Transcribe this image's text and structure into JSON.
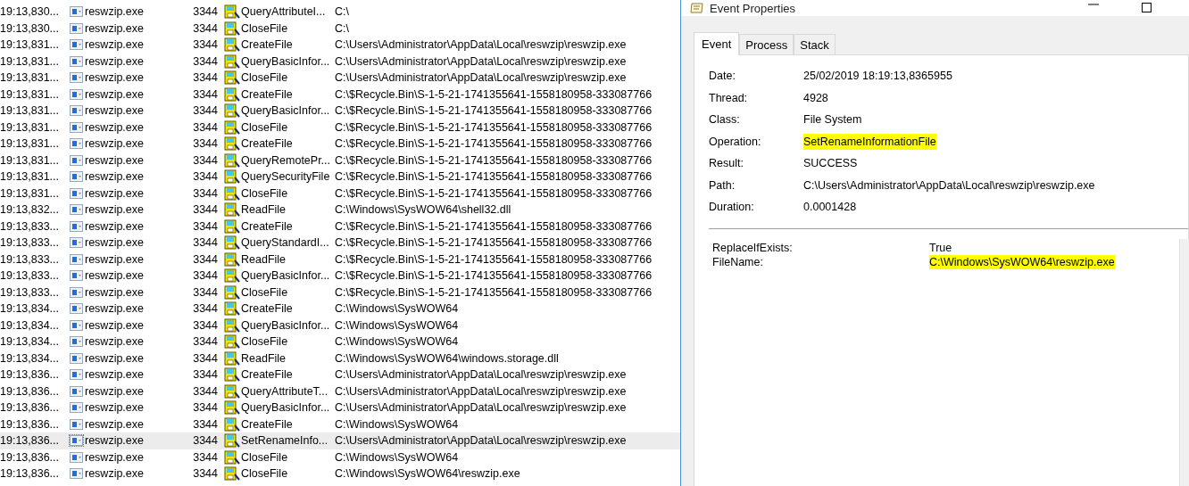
{
  "events": [
    {
      "time": "19:13,830...",
      "process": "reswzip.exe",
      "pid": "3344",
      "operation": "QueryAttributeI...",
      "path": "C:\\",
      "selected": false
    },
    {
      "time": "19:13,830...",
      "process": "reswzip.exe",
      "pid": "3344",
      "operation": "CloseFile",
      "path": "C:\\",
      "selected": false
    },
    {
      "time": "19:13,831...",
      "process": "reswzip.exe",
      "pid": "3344",
      "operation": "CreateFile",
      "path": "C:\\Users\\Administrator\\AppData\\Local\\reswzip\\reswzip.exe",
      "selected": false
    },
    {
      "time": "19:13,831...",
      "process": "reswzip.exe",
      "pid": "3344",
      "operation": "QueryBasicInfor...",
      "path": "C:\\Users\\Administrator\\AppData\\Local\\reswzip\\reswzip.exe",
      "selected": false
    },
    {
      "time": "19:13,831...",
      "process": "reswzip.exe",
      "pid": "3344",
      "operation": "CloseFile",
      "path": "C:\\Users\\Administrator\\AppData\\Local\\reswzip\\reswzip.exe",
      "selected": false
    },
    {
      "time": "19:13,831...",
      "process": "reswzip.exe",
      "pid": "3344",
      "operation": "CreateFile",
      "path": "C:\\$Recycle.Bin\\S-1-5-21-1741355641-1558180958-333087766",
      "selected": false
    },
    {
      "time": "19:13,831...",
      "process": "reswzip.exe",
      "pid": "3344",
      "operation": "QueryBasicInfor...",
      "path": "C:\\$Recycle.Bin\\S-1-5-21-1741355641-1558180958-333087766",
      "selected": false
    },
    {
      "time": "19:13,831...",
      "process": "reswzip.exe",
      "pid": "3344",
      "operation": "CloseFile",
      "path": "C:\\$Recycle.Bin\\S-1-5-21-1741355641-1558180958-333087766",
      "selected": false
    },
    {
      "time": "19:13,831...",
      "process": "reswzip.exe",
      "pid": "3344",
      "operation": "CreateFile",
      "path": "C:\\$Recycle.Bin\\S-1-5-21-1741355641-1558180958-333087766",
      "selected": false
    },
    {
      "time": "19:13,831...",
      "process": "reswzip.exe",
      "pid": "3344",
      "operation": "QueryRemotePr...",
      "path": "C:\\$Recycle.Bin\\S-1-5-21-1741355641-1558180958-333087766",
      "selected": false
    },
    {
      "time": "19:13,831...",
      "process": "reswzip.exe",
      "pid": "3344",
      "operation": "QuerySecurityFile",
      "path": "C:\\$Recycle.Bin\\S-1-5-21-1741355641-1558180958-333087766",
      "selected": false
    },
    {
      "time": "19:13,831...",
      "process": "reswzip.exe",
      "pid": "3344",
      "operation": "CloseFile",
      "path": "C:\\$Recycle.Bin\\S-1-5-21-1741355641-1558180958-333087766",
      "selected": false
    },
    {
      "time": "19:13,832...",
      "process": "reswzip.exe",
      "pid": "3344",
      "operation": "ReadFile",
      "path": "C:\\Windows\\SysWOW64\\shell32.dll",
      "selected": false
    },
    {
      "time": "19:13,833...",
      "process": "reswzip.exe",
      "pid": "3344",
      "operation": "CreateFile",
      "path": "C:\\$Recycle.Bin\\S-1-5-21-1741355641-1558180958-333087766",
      "selected": false
    },
    {
      "time": "19:13,833...",
      "process": "reswzip.exe",
      "pid": "3344",
      "operation": "QueryStandardI...",
      "path": "C:\\$Recycle.Bin\\S-1-5-21-1741355641-1558180958-333087766",
      "selected": false
    },
    {
      "time": "19:13,833...",
      "process": "reswzip.exe",
      "pid": "3344",
      "operation": "ReadFile",
      "path": "C:\\$Recycle.Bin\\S-1-5-21-1741355641-1558180958-333087766",
      "selected": false
    },
    {
      "time": "19:13,833...",
      "process": "reswzip.exe",
      "pid": "3344",
      "operation": "QueryBasicInfor...",
      "path": "C:\\$Recycle.Bin\\S-1-5-21-1741355641-1558180958-333087766",
      "selected": false
    },
    {
      "time": "19:13,833...",
      "process": "reswzip.exe",
      "pid": "3344",
      "operation": "CloseFile",
      "path": "C:\\$Recycle.Bin\\S-1-5-21-1741355641-1558180958-333087766",
      "selected": false
    },
    {
      "time": "19:13,834...",
      "process": "reswzip.exe",
      "pid": "3344",
      "operation": "CreateFile",
      "path": "C:\\Windows\\SysWOW64",
      "selected": false
    },
    {
      "time": "19:13,834...",
      "process": "reswzip.exe",
      "pid": "3344",
      "operation": "QueryBasicInfor...",
      "path": "C:\\Windows\\SysWOW64",
      "selected": false
    },
    {
      "time": "19:13,834...",
      "process": "reswzip.exe",
      "pid": "3344",
      "operation": "CloseFile",
      "path": "C:\\Windows\\SysWOW64",
      "selected": false
    },
    {
      "time": "19:13,834...",
      "process": "reswzip.exe",
      "pid": "3344",
      "operation": "ReadFile",
      "path": "C:\\Windows\\SysWOW64\\windows.storage.dll",
      "selected": false
    },
    {
      "time": "19:13,836...",
      "process": "reswzip.exe",
      "pid": "3344",
      "operation": "CreateFile",
      "path": "C:\\Users\\Administrator\\AppData\\Local\\reswzip\\reswzip.exe",
      "selected": false
    },
    {
      "time": "19:13,836...",
      "process": "reswzip.exe",
      "pid": "3344",
      "operation": "QueryAttributeT...",
      "path": "C:\\Users\\Administrator\\AppData\\Local\\reswzip\\reswzip.exe",
      "selected": false
    },
    {
      "time": "19:13,836...",
      "process": "reswzip.exe",
      "pid": "3344",
      "operation": "QueryBasicInfor...",
      "path": "C:\\Users\\Administrator\\AppData\\Local\\reswzip\\reswzip.exe",
      "selected": false
    },
    {
      "time": "19:13,836...",
      "process": "reswzip.exe",
      "pid": "3344",
      "operation": "CreateFile",
      "path": "C:\\Windows\\SysWOW64",
      "selected": false
    },
    {
      "time": "19:13,836...",
      "process": "reswzip.exe",
      "pid": "3344",
      "operation": "SetRenameInfo...",
      "path": "C:\\Users\\Administrator\\AppData\\Local\\reswzip\\reswzip.exe",
      "selected": true
    },
    {
      "time": "19:13,836...",
      "process": "reswzip.exe",
      "pid": "3344",
      "operation": "CloseFile",
      "path": "C:\\Windows\\SysWOW64",
      "selected": false
    },
    {
      "time": "19:13,836...",
      "process": "reswzip.exe",
      "pid": "3344",
      "operation": "CloseFile",
      "path": "C:\\Windows\\SysWOW64\\reswzip.exe",
      "selected": false
    }
  ],
  "dialog": {
    "title": "Event Properties",
    "tabs": [
      {
        "label": "Event",
        "selected": true
      },
      {
        "label": "Process",
        "selected": false
      },
      {
        "label": "Stack",
        "selected": false
      }
    ],
    "fields": [
      {
        "label": "Date:",
        "value": "25/02/2019 18:19:13,8365955",
        "highlighted": false
      },
      {
        "label": "Thread:",
        "value": "4928",
        "highlighted": false
      },
      {
        "label": "Class:",
        "value": "File System",
        "highlighted": false
      },
      {
        "label": "Operation:",
        "value": "SetRenameInformationFile",
        "highlighted": true
      },
      {
        "label": "Result:",
        "value": "SUCCESS",
        "highlighted": false
      },
      {
        "label": "Path:",
        "value": "C:\\Users\\Administrator\\AppData\\Local\\reswzip\\reswzip.exe",
        "highlighted": false
      },
      {
        "label": "Duration:",
        "value": "0.0001428",
        "highlighted": false
      }
    ],
    "details": [
      {
        "label": "ReplaceIfExists:",
        "value": "True",
        "highlighted": false
      },
      {
        "label": "FileName:",
        "value": "C:\\Windows\\SysWOW64\\reswzip.exe",
        "highlighted": true
      }
    ]
  }
}
